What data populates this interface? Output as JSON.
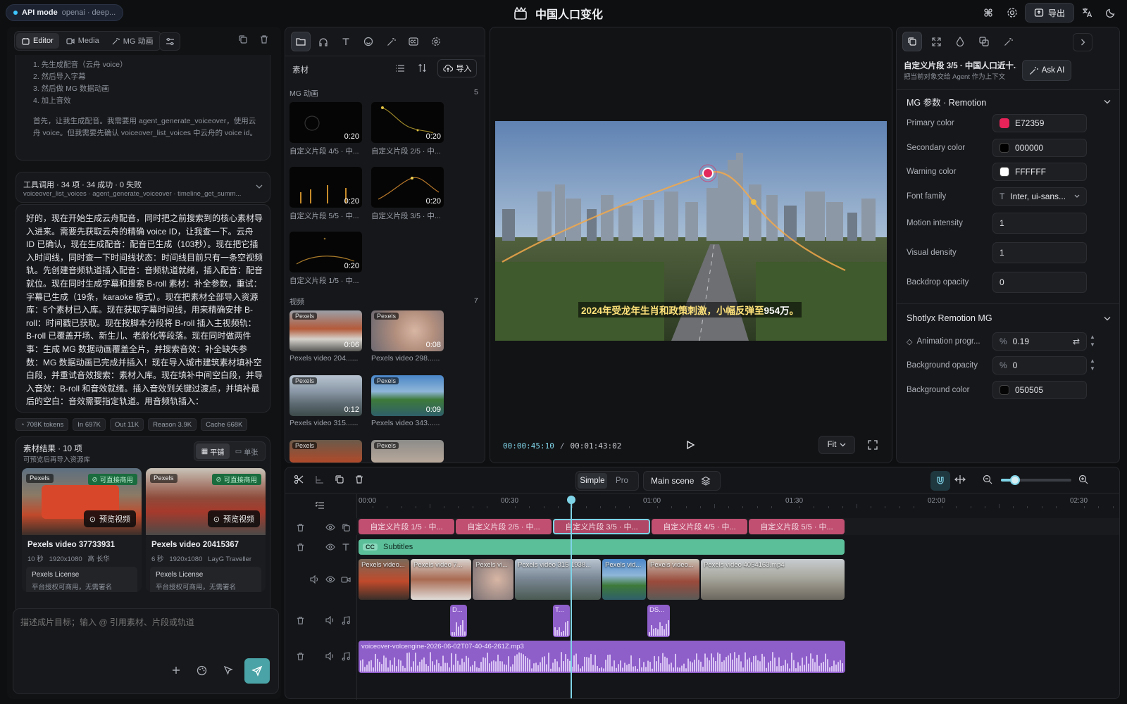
{
  "topbar": {
    "api_mode": "API mode",
    "api_detail": "openai · deep...",
    "title": "中国人口变化",
    "export_label": "导出"
  },
  "left": {
    "tabs": [
      {
        "label": "Editor"
      },
      {
        "label": "Media"
      },
      {
        "label": "MG 动画"
      }
    ],
    "plan_steps": [
      "1. 先生成配音（云舟 voice）",
      "2. 然后导入字幕",
      "3. 然后做 MG 数据动画",
      "4. 加上音效"
    ],
    "thinking": "首先，让我生成配音。我需要用 agent_generate_voiceover，使用云舟 voice。但我需要先确认 voiceover_list_voices 中云舟的 voice id。",
    "tool_summary_title": "工具调用 · 34 项 · 34 成功 · 0 失败",
    "tool_summary_sub": "voiceover_list_voices · agent_generate_voiceover · timeline_get_summ...",
    "message": "好的，现在开始生成云舟配音，同时把之前搜索到的核心素材导入进来。需要先获取云舟的精确 voice ID，让我查一下。云舟 ID 已确认，现在生成配音：配音已生成（103秒）。现在把它插入时间线，同时查一下时间线状态：时间线目前只有一条空视频轨。先创建音频轨道插入配音：音频轨道就绪，插入配音：配音就位。现在同时生成字幕和搜索 B-roll 素材：补全参数，重试：字幕已生成（19条，karaoke 模式）。现在把素材全部导入资源库：5个素材已入库。现在获取字幕时间线，用来精确安排 B-roll：时间戳已获取。现在按脚本分段将 B-roll 插入主视频轨：B-roll 已覆盖开场、新生儿、老龄化等段落。现在同时做两件事：生成 MG 数据动画覆盖全片，并搜索音效：补全缺失参数：MG 数据动画已完成并插入！现在导入城市建筑素材填补空白段，并重试音效搜索：素材入库。现在填补中间空白段，并导入音效：B-roll 和音效就绪。插入音效到关键过渡点，并填补最后的空白：音效需要指定轨道。用音频轨插入：",
    "tokens": [
      "708K tokens",
      "In 697K",
      "Out 11K",
      "Reason 3.9K",
      "Cache 668K"
    ],
    "results_title": "素材结果 · 10 项",
    "results_sub": "可预览后再导入资源库",
    "view_grid": "平铺",
    "view_single": "单张",
    "results": [
      {
        "source": "Pexels",
        "ok": "可直接商用",
        "preview": "预览视频",
        "name": "Pexels video 37733931",
        "meta": "10 秒   1920x1080   高 长华",
        "license": "Pexels License",
        "license_sub": "平台授权可商用，无需署名"
      },
      {
        "source": "Pexels",
        "ok": "可直接商用",
        "preview": "预览视频",
        "name": "Pexels video 20415367",
        "meta": "6 秒   1920x1080   LayG Traveller",
        "license": "Pexels License",
        "license_sub": "平台授权可商用，无需署名"
      }
    ],
    "composer_placeholder": "描述成片目标；输入 @ 引用素材、片段或轨道"
  },
  "assets": {
    "title": "素材",
    "import_label": "导入",
    "mg_section": "MG 动画",
    "mg_count": "5",
    "mg_items": [
      {
        "label": "自定义片段 4/5 · 中...",
        "dur": "0:20"
      },
      {
        "label": "自定义片段 2/5 · 中...",
        "dur": "0:20"
      },
      {
        "label": "自定义片段 5/5 · 中...",
        "dur": "0:20"
      },
      {
        "label": "自定义片段 3/5 · 中...",
        "dur": "0:20"
      },
      {
        "label": "自定义片段 1/5 · 中...",
        "dur": "0:20"
      }
    ],
    "video_section": "视频",
    "video_count": "7",
    "video_items": [
      {
        "label": "Pexels video 204......",
        "dur": "0:06",
        "badge": "Pexels"
      },
      {
        "label": "Pexels video 298......",
        "dur": "0:08",
        "badge": "Pexels"
      },
      {
        "label": "Pexels video 315......",
        "dur": "0:12",
        "badge": "Pexels"
      },
      {
        "label": "Pexels video 343......",
        "dur": "0:09",
        "badge": "Pexels"
      },
      {
        "label": "",
        "dur": "",
        "badge": "Pexels"
      },
      {
        "label": "",
        "dur": "",
        "badge": "Pexels"
      }
    ]
  },
  "preview": {
    "subtitle_pre": "2024年受龙年生肖和政策刺激，小幅反弹至",
    "subtitle_hl": "954万",
    "subtitle_post": "。",
    "time_current": "00:00:45:10",
    "time_sep": "/",
    "time_total": "00:01:43:02",
    "fit_label": "Fit"
  },
  "props": {
    "clip_title": "自定义片段 3/5 · 中国人口近十...",
    "clip_sub": "把当前对象交给 Agent 作为上下文",
    "ask_ai": "Ask AI",
    "section1": "MG 参数 · Remotion",
    "rows": [
      {
        "label": "Primary color",
        "value": "E72359",
        "swatch": "#E72359"
      },
      {
        "label": "Secondary color",
        "value": "000000",
        "swatch": "#000000"
      },
      {
        "label": "Warning color",
        "value": "FFFFFF",
        "swatch": "#FFFFFF"
      },
      {
        "label": "Font family",
        "value": "Inter, ui-sans..."
      },
      {
        "label": "Motion intensity",
        "value": "1"
      },
      {
        "label": "Visual density",
        "value": "1"
      },
      {
        "label": "Backdrop opacity",
        "value": "0"
      }
    ],
    "section2": "Shotlyx Remotion MG",
    "rows2": [
      {
        "label": "Animation progr...",
        "prefix": "%",
        "value": "0.19"
      },
      {
        "label": "Background opacity",
        "prefix": "%",
        "value": "0"
      },
      {
        "label": "Background color",
        "value": "050505",
        "swatch": "#050505"
      }
    ]
  },
  "timeline": {
    "mode_simple": "Simple",
    "mode_pro": "Pro",
    "scene": "Main scene",
    "ruler": [
      "00:00",
      "00:30",
      "01:00",
      "01:30",
      "02:00",
      "02:30"
    ],
    "mg_clips": [
      "自定义片段 1/5 · 中...",
      "自定义片段 2/5 · 中...",
      "自定义片段 3/5 · 中...",
      "自定义片段 4/5 · 中...",
      "自定义片段 5/5 · 中..."
    ],
    "subtitles_label": "Subtitles",
    "subtitles_badge": "CC",
    "video_clips": [
      "Pexels video...",
      "Pexels video 7...",
      "Pexels vi...",
      "Pexels video 315 1938...",
      "Pexels vid...",
      "Pexels video...",
      "Pexels video 4054163.mp4"
    ],
    "sfx_clips": [
      "D...",
      "T...",
      "DS..."
    ],
    "voiceover_label": "voiceover-volcengine-2026-06-02T07-40-46-261Z.mp3",
    "playhead_position": "00:00:45:10",
    "zoom_level": 0.2
  },
  "colors": {
    "accent": "#7fd3e6",
    "mg_clip": "#c04f71",
    "subtitle_clip": "#5bbf9a",
    "audio_clip": "#8e5ec9",
    "send": "#4aa3a6"
  }
}
